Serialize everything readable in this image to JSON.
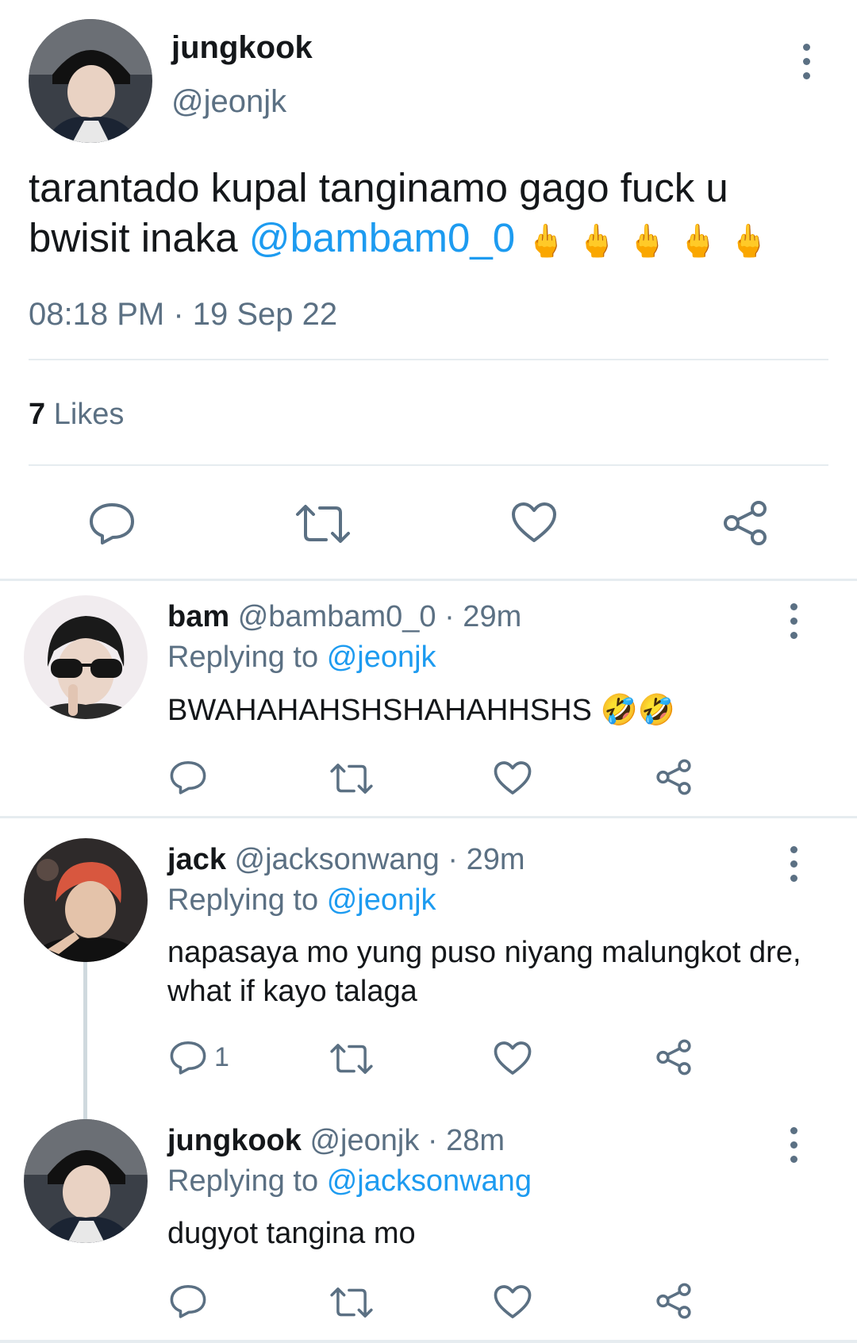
{
  "tweet": {
    "author_name": "jungkook",
    "author_handle": "@jeonjk",
    "text_part1": "tarantado kupal tanginamo gago fuck u bwisit inaka ",
    "mention": "@bambam0_0",
    "emoji": "🖕🖕🖕🖕🖕",
    "timestamp": "08:18 PM · 19 Sep 22",
    "likes_count": "7",
    "likes_label": "Likes"
  },
  "replies": [
    {
      "author_name": "bam",
      "author_handle": "@bambam0_0",
      "time": "· 29m",
      "replying_label": "Replying to",
      "replying_handle": "@jeonjk",
      "text": "BWAHAHAHSHSHAHAHHSHS 🤣🤣",
      "reply_count": ""
    },
    {
      "author_name": "jack",
      "author_handle": "@jacksonwang",
      "time": "· 29m",
      "replying_label": "Replying to",
      "replying_handle": "@jeonjk",
      "text": "napasaya mo yung puso niyang malungkot dre, what if kayo talaga",
      "reply_count": "1"
    },
    {
      "author_name": "jungkook",
      "author_handle": "@jeonjk",
      "time": "· 28m",
      "replying_label": "Replying to",
      "replying_handle": "@jacksonwang",
      "text": "dugyot tangina mo",
      "reply_count": ""
    }
  ],
  "icons": {
    "reply": "reply-icon",
    "retweet": "retweet-icon",
    "like": "heart-icon",
    "share": "share-icon",
    "more": "more-icon"
  },
  "colors": {
    "link": "#1d9bf0",
    "muted": "#5b7083",
    "divider": "#e6ecf0"
  }
}
